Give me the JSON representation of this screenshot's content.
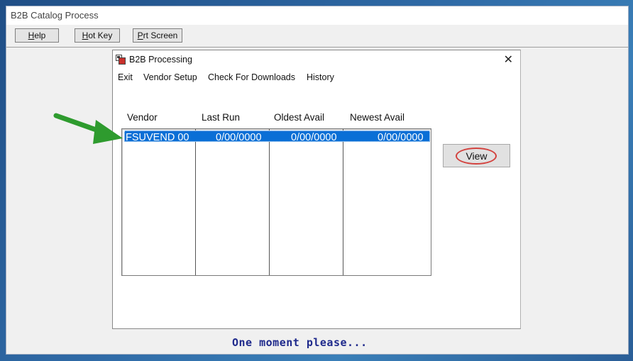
{
  "window": {
    "title": "B2B Catalog Process"
  },
  "toolbar": {
    "help": {
      "u": "H",
      "rest": "elp"
    },
    "hotkey": {
      "u": "H",
      "rest": "ot Key"
    },
    "prtscreen": {
      "u": "P",
      "rest": "rt Screen"
    }
  },
  "dialog": {
    "title": "B2B Processing",
    "menu": [
      "Exit",
      "Vendor Setup",
      "Check For Downloads",
      "History"
    ],
    "columns": [
      "Vendor",
      "Last Run",
      "Oldest Avail",
      "Newest Avail"
    ],
    "rows": [
      {
        "vendor": "FSUVEND 00",
        "last_run": "0/00/0000",
        "oldest_avail": "0/00/0000",
        "newest_avail": "0/00/0000"
      }
    ],
    "view_button": "View"
  },
  "status": {
    "message": "One moment please..."
  },
  "colors": {
    "selection": "#0a6fd6",
    "highlight_oval": "#d3423e",
    "arrow": "#2e9b2e",
    "status_text": "#1f2a8c"
  },
  "icons": [
    "app-icon",
    "close-icon",
    "arrow-annotation-icon"
  ]
}
